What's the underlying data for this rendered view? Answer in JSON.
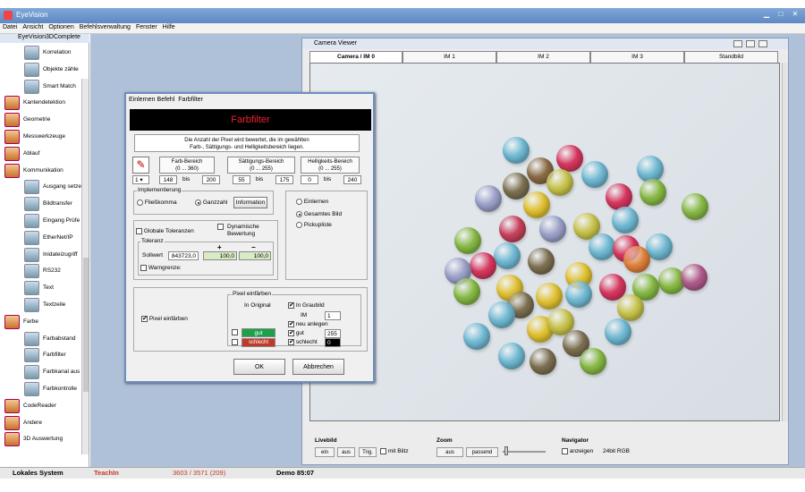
{
  "app": {
    "title": "EyeVision"
  },
  "menu": [
    "Datei",
    "Ansicht",
    "Optionen",
    "Befehlsverwaltung",
    "Fenster",
    "Hilfe"
  ],
  "toolpanel": {
    "header": "EyeVision3DComplete",
    "items": [
      {
        "label": "Korrelation",
        "icon": "correlation-icon",
        "level": 1
      },
      {
        "label": "Objekte zähle",
        "icon": "count-icon",
        "level": 1
      },
      {
        "label": "Smart Match",
        "icon": "smart-match-icon",
        "level": 1
      },
      {
        "label": "Kantendetektion",
        "icon": "toolbox-icon",
        "level": 0
      },
      {
        "label": "Geometrie",
        "icon": "toolbox-icon",
        "level": 0
      },
      {
        "label": "Messwerkzeuge",
        "icon": "toolbox-icon",
        "level": 0
      },
      {
        "label": "Ablauf",
        "icon": "toolbox-icon",
        "level": 0
      },
      {
        "label": "Kommunikation",
        "icon": "toolbox-icon",
        "level": 0
      },
      {
        "label": "Ausgang setze",
        "icon": "output-icon",
        "level": 1
      },
      {
        "label": "Bildtransfer",
        "icon": "transfer-icon",
        "level": 1
      },
      {
        "label": "Eingang Prüfe",
        "icon": "input-icon",
        "level": 1
      },
      {
        "label": "EtherNet/IP",
        "icon": "network-icon",
        "level": 1
      },
      {
        "label": "Inidateizugriff",
        "icon": "ini-icon",
        "level": 1
      },
      {
        "label": "RS232",
        "icon": "rs232-icon",
        "level": 1
      },
      {
        "label": "Text",
        "icon": "text-icon",
        "level": 1
      },
      {
        "label": "Textzeile",
        "icon": "abc-icon",
        "level": 1
      },
      {
        "label": "Farbe",
        "icon": "toolbox-icon",
        "level": 0
      },
      {
        "label": "Farbabstand",
        "icon": "color-icon",
        "level": 1
      },
      {
        "label": "Farbfilter",
        "icon": "color-icon",
        "level": 1
      },
      {
        "label": "Farbkanal aus",
        "icon": "color-icon",
        "level": 1
      },
      {
        "label": "Farbkontrolle",
        "icon": "color-icon",
        "level": 1
      },
      {
        "label": "CodeReader",
        "icon": "toolbox-icon",
        "level": 0
      },
      {
        "label": "Andere",
        "icon": "toolbox-icon",
        "level": 0
      },
      {
        "label": "3D Auswertung",
        "icon": "toolbox-icon",
        "level": 0
      }
    ]
  },
  "camera": {
    "title": "Camera Viewer",
    "tabs": [
      "Camera / IM 0",
      "IM 1",
      "IM 2",
      "IM 3",
      "Standbild"
    ],
    "livebild": {
      "label": "Livebild",
      "on": "ein",
      "off": "aus",
      "trig": "Trig.",
      "flash": "mit Blitz"
    },
    "zoom": {
      "label": "Zoom",
      "off": "aus",
      "fit": "passend"
    },
    "navigator": {
      "label": "Navigator",
      "show": "anzeigen",
      "mode": "24bit RGB"
    }
  },
  "dialog": {
    "menu": [
      "Einlernen",
      "Befehl",
      "Farbfilter"
    ],
    "title": "Farbfilter",
    "desc1": "Die Anzahl der Pixel wird bewertet, die im gewählten",
    "desc2": "Farb-, Sättigungs- und Helligkeitsbereich liegen.",
    "picker_value": "1",
    "hue": {
      "label": "Farb-Bereich",
      "range": "(0 ... 360)",
      "min": "148",
      "max": "200"
    },
    "sat": {
      "label": "Sättigungs-Bereich",
      "range": "(0 ... 255)",
      "min": "55",
      "max": "175"
    },
    "bri": {
      "label": "Helligkeits-Bereich",
      "range": "(0 ... 255)",
      "min": "0",
      "max": "240"
    },
    "bis": "bis",
    "impl": {
      "label": "Implementierung",
      "float": "Fließkomma",
      "int": "Ganzzahl",
      "info": "Information"
    },
    "learn": {
      "einlernen": "Einlernen",
      "gesamt": "Gesamtes Bild",
      "pick": "Pickupliste"
    },
    "tol": {
      "global": "Globale Toleranzen",
      "dynamic1": "Dynamische",
      "dynamic2": "Bewertung",
      "label": "Toleranz",
      "plus": "+",
      "minus": "−",
      "sollwert": "Sollwert",
      "value": "843723,0",
      "plus_val": "100,0",
      "minus_val": "100,0",
      "warn": "Warngrenze:"
    },
    "pixel": {
      "color": "Pixel einfärben",
      "group": "Pixel einfärben",
      "original": "In Original",
      "gray": "In Graubild",
      "im": "IM",
      "im_val": "1",
      "new": "neu anlegen",
      "gut": "gut",
      "gut_val": "255",
      "schlecht": "schlecht",
      "schlecht_val": "0",
      "gut_color": "#1ea04a",
      "bad_color": "#c0392b"
    },
    "ok": "OK",
    "cancel": "Abbrechen"
  },
  "status": {
    "system": "Lokales System",
    "mode": "TeachIn",
    "counts": "3603 / 3571 (209)",
    "demo": "Demo 85:07"
  }
}
